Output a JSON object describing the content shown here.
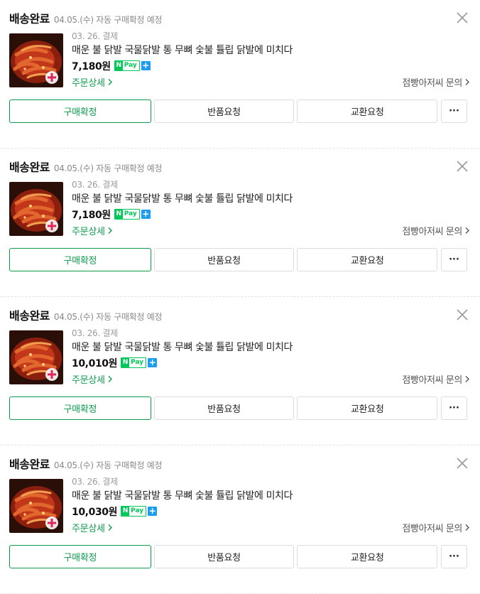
{
  "colors": {
    "accent_green": "#0e9a4e",
    "npay_green": "#03c75a",
    "npay_plus_blue": "#1e9cf0"
  },
  "orders": [
    {
      "status": "배송완료",
      "status_detail": "04.05.(수) 자동 구매확정 예정",
      "pay_date": "03. 26. 결제",
      "product_title": "매운 불 닭발 국물닭발 통 무뼈 숯불 튤립 닭발에 미치다",
      "price": "7,180원",
      "npay_n": "N",
      "npay_text": "Pay",
      "npay_plus": "+",
      "order_detail_label": "주문상세",
      "seller_contact_label": "점빵아저씨 문의",
      "confirm_label": "구매확정",
      "return_label": "반품요청",
      "exchange_label": "교환요청",
      "more_label": "···",
      "close_icon": "close-icon",
      "thumbnail": "chicken-feet-dish-image"
    },
    {
      "status": "배송완료",
      "status_detail": "04.05.(수) 자동 구매확정 예정",
      "pay_date": "03. 26. 결제",
      "product_title": "매운 불 닭발 국물닭발 통 무뼈 숯불 튤립 닭발에 미치다",
      "price": "7,180원",
      "npay_n": "N",
      "npay_text": "Pay",
      "npay_plus": "+",
      "order_detail_label": "주문상세",
      "seller_contact_label": "점빵아저씨 문의",
      "confirm_label": "구매확정",
      "return_label": "반품요청",
      "exchange_label": "교환요청",
      "more_label": "···",
      "close_icon": "close-icon",
      "thumbnail": "chicken-feet-dish-image"
    },
    {
      "status": "배송완료",
      "status_detail": "04.05.(수) 자동 구매확정 예정",
      "pay_date": "03. 26. 결제",
      "product_title": "매운 불 닭발 국물닭발 통 무뼈 숯불 튤립 닭발에 미치다",
      "price": "10,010원",
      "npay_n": "N",
      "npay_text": "Pay",
      "npay_plus": "+",
      "order_detail_label": "주문상세",
      "seller_contact_label": "점빵아저씨 문의",
      "confirm_label": "구매확정",
      "return_label": "반품요청",
      "exchange_label": "교환요청",
      "more_label": "···",
      "close_icon": "close-icon",
      "thumbnail": "chicken-feet-dish-image"
    },
    {
      "status": "배송완료",
      "status_detail": "04.05.(수) 자동 구매확정 예정",
      "pay_date": "03. 26. 결제",
      "product_title": "매운 불 닭발 국물닭발 통 무뼈 숯불 튤립 닭발에 미치다",
      "price": "10,030원",
      "npay_n": "N",
      "npay_text": "Pay",
      "npay_plus": "+",
      "order_detail_label": "주문상세",
      "seller_contact_label": "점빵아저씨 문의",
      "confirm_label": "구매확정",
      "return_label": "반품요청",
      "exchange_label": "교환요청",
      "more_label": "···",
      "close_icon": "close-icon",
      "thumbnail": "chicken-feet-dish-image"
    }
  ]
}
